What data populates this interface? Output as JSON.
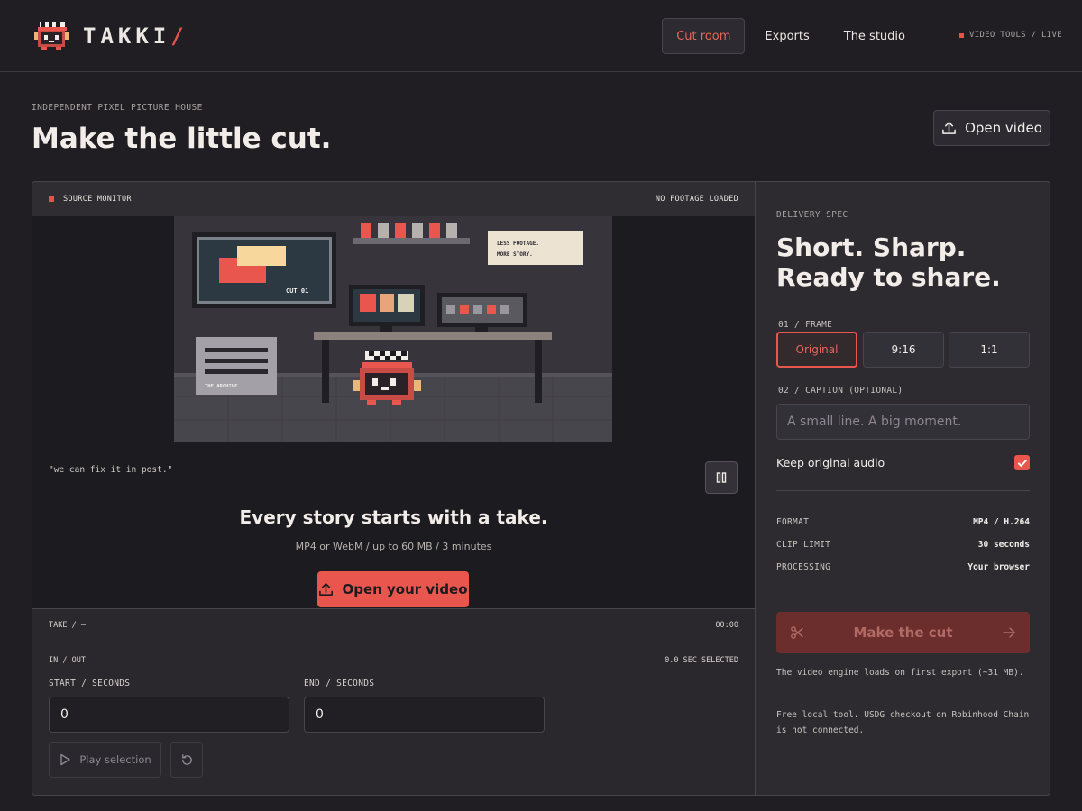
{
  "header": {
    "brand": "TAKKI",
    "brand_mark": "/",
    "nav": [
      {
        "label": "Cut room",
        "active": true
      },
      {
        "label": "Exports",
        "active": false
      },
      {
        "label": "The studio",
        "active": false
      }
    ],
    "status": "VIDEO TOOLS / LIVE"
  },
  "page": {
    "eyebrow": "INDEPENDENT PIXEL PICTURE HOUSE",
    "title": "Make the little cut.",
    "open_button": "Open video",
    "open_icon": "upload-icon"
  },
  "monitor": {
    "label": "SOURCE MONITOR",
    "status": "NO FOOTAGE LOADED",
    "scene_text": {
      "screen_label": "CUT 01",
      "poster_line1": "LESS FOOTAGE.",
      "poster_line2": "MORE STORY.",
      "box_label": "THE ARCHIVE"
    },
    "quote": "\"we can fix it in post.\"",
    "empty_title": "Every story starts with a take.",
    "empty_sub": "MP4 or WebM / up to 60 MB / 3 minutes",
    "open_button": "Open your video",
    "take_label": "TAKE / —",
    "timecode": "00:00"
  },
  "trim": {
    "label": "IN / OUT",
    "selected": "0.0 SEC SELECTED",
    "start_label": "START / SECONDS",
    "start_value": "0",
    "end_label": "END / SECONDS",
    "end_value": "0",
    "play_button": "Play selection",
    "reset_icon": "reset-icon"
  },
  "delivery": {
    "eyebrow": "DELIVERY SPEC",
    "title_line1": "Short. Sharp.",
    "title_line2": "Ready to share.",
    "frame_label": "01 / FRAME",
    "frames": [
      {
        "label": "Original",
        "selected": true
      },
      {
        "label": "9:16",
        "selected": false
      },
      {
        "label": "1:1",
        "selected": false
      }
    ],
    "caption_label": "02 / CAPTION (OPTIONAL)",
    "caption_placeholder": "A small line. A big moment.",
    "audio_label": "Keep original audio",
    "audio_checked": true,
    "specs": [
      {
        "key": "FORMAT",
        "value": "MP4 / H.264"
      },
      {
        "key": "CLIP LIMIT",
        "value": "30 seconds"
      },
      {
        "key": "PROCESSING",
        "value": "Your browser"
      }
    ],
    "cut_button": "Make the cut",
    "note1": "The video engine loads on first export (~31 MB).",
    "note2": "Free local tool. USDG checkout on Robinhood Chain is not connected."
  },
  "colors": {
    "background": "#201e23",
    "accent": "#e8564d",
    "panel": "#2a282d"
  }
}
